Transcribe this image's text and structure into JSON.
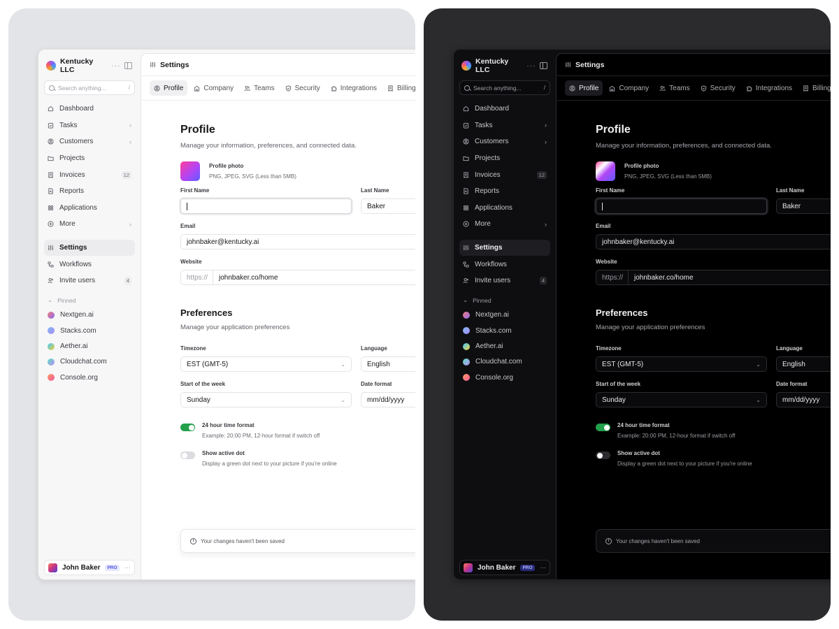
{
  "workspace": {
    "name": "Kentucky LLC",
    "more": "···"
  },
  "search": {
    "placeholder": "Search anything...",
    "shortcut": "/"
  },
  "nav": [
    {
      "label": "Dashboard",
      "icon": "home-icon"
    },
    {
      "label": "Tasks",
      "icon": "clipboard-check-icon",
      "chevron": "›"
    },
    {
      "label": "Customers",
      "icon": "user-circle-icon",
      "chevron": "›"
    },
    {
      "label": "Projects",
      "icon": "folder-icon"
    },
    {
      "label": "Invoices",
      "icon": "receipt-icon",
      "badge": "12"
    },
    {
      "label": "Reports",
      "icon": "report-icon"
    },
    {
      "label": "Applications",
      "icon": "grid-icon"
    },
    {
      "label": "More",
      "icon": "plus-circle-icon",
      "chevron": "›"
    }
  ],
  "nav2": [
    {
      "label": "Settings",
      "icon": "sliders-icon",
      "active": true
    },
    {
      "label": "Workflows",
      "icon": "workflow-icon"
    },
    {
      "label": "Invite users",
      "icon": "user-plus-icon",
      "badge": "4"
    }
  ],
  "pinned": {
    "title": "Pinned",
    "items": [
      {
        "label": "Nextgen.ai",
        "colors": [
          "#f47c7c",
          "#8b6cf0"
        ]
      },
      {
        "label": "Stacks.com",
        "colors": [
          "#7fb8f5",
          "#a88cf3"
        ]
      },
      {
        "label": "Aether.ai",
        "colors": [
          "#3ec6ff",
          "#f5d23b"
        ]
      },
      {
        "label": "Cloudchat.com",
        "colors": [
          "#5ce0c0",
          "#b88ef5"
        ]
      },
      {
        "label": "Console.org",
        "colors": [
          "#ff9a62",
          "#f05a9b"
        ]
      }
    ]
  },
  "user": {
    "name": "John Baker",
    "badge": "PRO",
    "more": "···"
  },
  "topbar": {
    "title": "Settings"
  },
  "tabs": [
    {
      "label": "Profile",
      "icon": "user-circle-icon",
      "active": true
    },
    {
      "label": "Company",
      "icon": "building-icon"
    },
    {
      "label": "Teams",
      "icon": "users-icon"
    },
    {
      "label": "Security",
      "icon": "shield-icon"
    },
    {
      "label": "Integrations",
      "icon": "puzzle-icon"
    },
    {
      "label": "Billing",
      "icon": "receipt-icon"
    }
  ],
  "profile": {
    "title": "Profile",
    "subtitle": "Manage your information, preferences, and connected data.",
    "photo_title": "Profile photo",
    "photo_hint": "PNG, JPEG, SVG (Less than 5MB)",
    "first_name_label": "First Name",
    "first_name_value": "",
    "last_name_label": "Last Name",
    "last_name_value": "Baker",
    "email_label": "Email",
    "email_value": "johnbaker@kentucky.ai",
    "website_label": "Website",
    "website_prefix": "https://",
    "website_value": "johnbaker.co/home"
  },
  "preferences": {
    "title": "Preferences",
    "subtitle": "Manage your application preferences",
    "timezone_label": "Timezone",
    "timezone_value": "EST (GMT-5)",
    "language_label": "Language",
    "language_value": "English",
    "week_label": "Start of the week",
    "week_value": "Sunday",
    "date_label": "Date format",
    "date_value": "mm/dd/yyyy",
    "toggle1_title": "24 hour time format",
    "toggle1_hint": "Example: 20:00 PM, 12-hour format if switch off",
    "toggle1_on": true,
    "toggle2_title": "Show active dot",
    "toggle2_hint": "Display a green dot next to your picture if you're online",
    "toggle2_on": false
  },
  "toast": {
    "text": "Your changes haven't been saved"
  },
  "colors": {
    "toggle_on": "#22a04b",
    "pro_badge": "#4f53d8"
  }
}
